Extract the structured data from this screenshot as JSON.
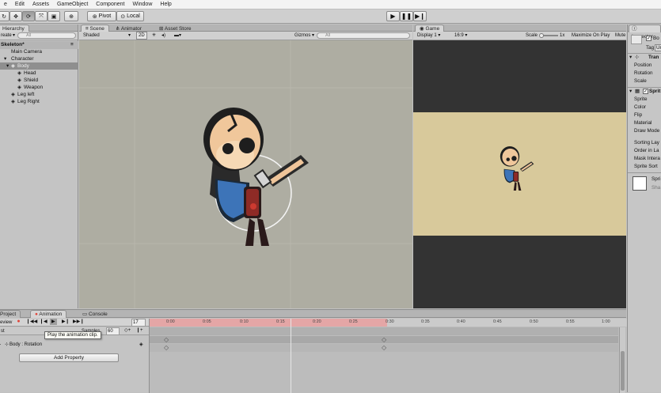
{
  "menu": [
    "e",
    "Edit",
    "Assets",
    "GameObject",
    "Component",
    "Window",
    "Help"
  ],
  "toolbar": {
    "pivot": "Pivot",
    "local": "Local"
  },
  "hierarchy": {
    "tab": "Hierarchy",
    "create": "reate",
    "search_placeholder": "All",
    "scene": "Skeleton*",
    "items": [
      "Main Camera",
      "Character",
      "Body",
      "Head",
      "Shield",
      "Weapon",
      "Leg left",
      "Leg Right"
    ]
  },
  "scene": {
    "tabs": [
      "Scene",
      "Animator",
      "Asset Store"
    ],
    "shaded": "Shaded",
    "mode2d": "2D",
    "gizmos": "Gizmos",
    "search_placeholder": "All"
  },
  "game": {
    "tab": "Game",
    "display": "Display 1",
    "aspect": "16:9",
    "scale_label": "Scale",
    "scale_value": "1x",
    "maximize": "Maximize On Play",
    "mute": "Mute"
  },
  "inspector": {
    "tab": "Inspector",
    "bo": "Bo",
    "tag_label": "Tag",
    "tag_value": "Un",
    "transform_header": "Tran",
    "transform_rows": [
      "Position",
      "Rotation",
      "Scale"
    ],
    "sprite_header": "Sprit",
    "sprite_rows": [
      "Sprite",
      "Color",
      "Flip",
      "Material",
      "Draw Mode",
      "Sorting Lay",
      "Order in La",
      "Mask Intera",
      "Sprite Sort"
    ],
    "sprite_preview": "Spri",
    "shader": "Sha"
  },
  "bottom": {
    "tabs": [
      "Project",
      "Animation",
      "Console"
    ],
    "preview": "eview",
    "frame": "17",
    "samples_label": "Samples",
    "samples_value": "60",
    "clip": "st",
    "property": "Body : Rotation",
    "add_property": "Add Property",
    "tooltip": "Play the animation clip.",
    "ticks": [
      "0:00",
      "0:05",
      "0:10",
      "0:15",
      "0:20",
      "0:25",
      "0:30",
      "0:35",
      "0:40",
      "0:45",
      "0:50",
      "0:55",
      "1:00"
    ]
  },
  "colors": {
    "record": "#e0453a",
    "timeline_red": "#e9a0a0",
    "game_bg": "#d8c99b",
    "game_bar": "#333333",
    "scene_bg": "#aeada2"
  }
}
